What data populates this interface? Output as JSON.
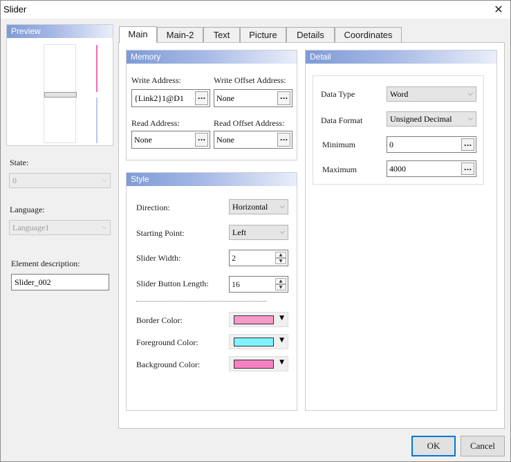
{
  "window": {
    "title": "Slider",
    "close_glyph": "✕"
  },
  "preview": {
    "title": "Preview",
    "track_colors": {
      "upper": "#f06bb7",
      "lower": "#b8c6f2"
    }
  },
  "state": {
    "label": "State:",
    "value": "0"
  },
  "language": {
    "label": "Language:",
    "value": "Language1"
  },
  "description": {
    "label": "Element description:",
    "value": "Slider_002"
  },
  "tabs": [
    {
      "label": "Main",
      "active": true
    },
    {
      "label": "Main-2"
    },
    {
      "label": "Text"
    },
    {
      "label": "Picture"
    },
    {
      "label": "Details"
    },
    {
      "label": "Coordinates"
    }
  ],
  "memory": {
    "title": "Memory",
    "write_address": {
      "label": "Write Address:",
      "value": "{Link2}1@D1"
    },
    "write_offset": {
      "label": "Write Offset Address:",
      "value": "None"
    },
    "read_address": {
      "label": "Read Address:",
      "value": "None"
    },
    "read_offset": {
      "label": "Read Offset Address:",
      "value": "None"
    },
    "browse_label": "..."
  },
  "style": {
    "title": "Style",
    "direction": {
      "label": "Direction:",
      "value": "Horizontal"
    },
    "starting_point": {
      "label": "Starting Point:",
      "value": "Left"
    },
    "slider_width": {
      "label": "Slider Width:",
      "value": "2"
    },
    "slider_button_length": {
      "label": "Slider Button Length:",
      "value": "16"
    },
    "border_color": {
      "label": "Border Color:",
      "color": "#f79ac7"
    },
    "foreground_color": {
      "label": "Foreground Color:",
      "color": "#7ff3ff"
    },
    "background_color": {
      "label": "Background Color:",
      "color": "#f57fc1"
    }
  },
  "detail": {
    "title": "Detail",
    "data_type": {
      "label": "Data Type",
      "value": "Word"
    },
    "data_format": {
      "label": "Data Format",
      "value": "Unsigned Decimal"
    },
    "minimum": {
      "label": "Minimum",
      "value": "0"
    },
    "maximum": {
      "label": "Maximum",
      "value": "4000"
    }
  },
  "icons": {
    "chevron": "⌵",
    "dropdown_arrow": "▼",
    "spin_up": "▲",
    "spin_down": "▼"
  },
  "buttons": {
    "ok": "OK",
    "cancel": "Cancel"
  }
}
